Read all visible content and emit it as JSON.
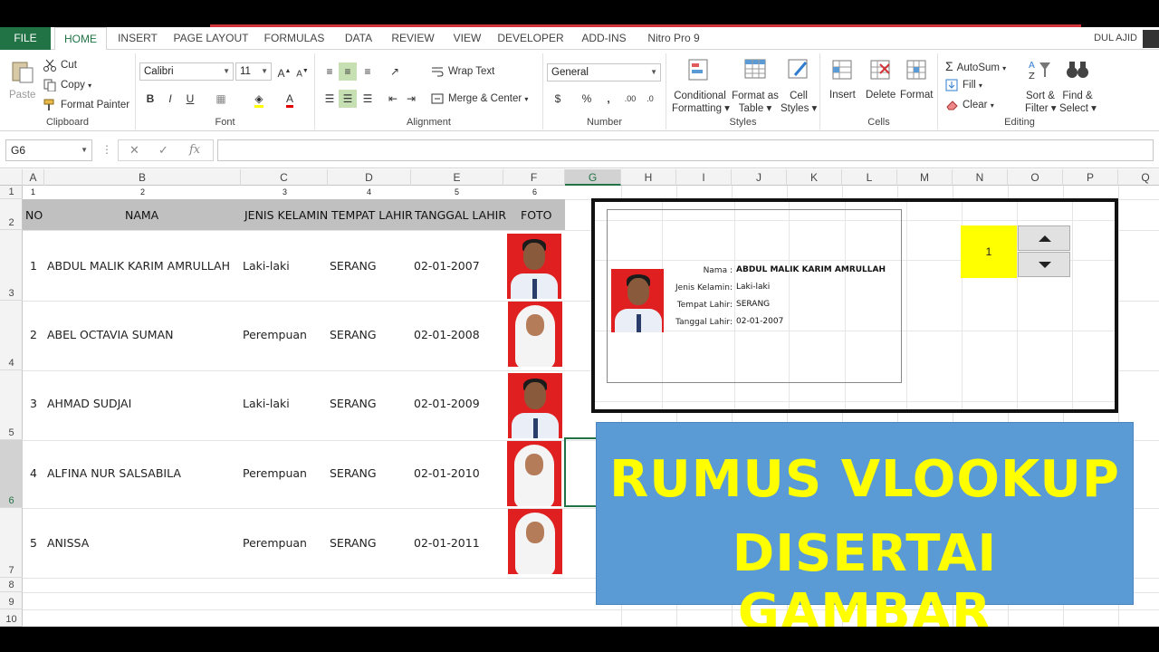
{
  "app": {
    "user": "DUL AJID",
    "accent": "#217346"
  },
  "tabs": [
    "FILE",
    "HOME",
    "INSERT",
    "PAGE LAYOUT",
    "FORMULAS",
    "DATA",
    "REVIEW",
    "VIEW",
    "DEVELOPER",
    "ADD-INS",
    "Nitro Pro 9"
  ],
  "ribbon": {
    "clipboard": {
      "paste": "Paste",
      "cut": "Cut",
      "copy": "Copy",
      "format_painter": "Format Painter",
      "label": "Clipboard"
    },
    "font": {
      "name": "Calibri",
      "size": "11",
      "label": "Font"
    },
    "alignment": {
      "wrap": "Wrap Text",
      "merge": "Merge & Center",
      "label": "Alignment"
    },
    "number": {
      "format": "General",
      "label": "Number"
    },
    "styles": {
      "conditional": [
        "Conditional",
        "Formatting"
      ],
      "format_table": [
        "Format as",
        "Table"
      ],
      "cell_styles": [
        "Cell",
        "Styles"
      ],
      "label": "Styles"
    },
    "cells": {
      "insert": "Insert",
      "delete": "Delete",
      "format": "Format",
      "label": "Cells"
    },
    "editing": {
      "autosum": "AutoSum",
      "fill": "Fill",
      "clear": "Clear",
      "sort": [
        "Sort &",
        "Filter"
      ],
      "find": [
        "Find &",
        "Select"
      ],
      "label": "Editing"
    }
  },
  "formula_bar": {
    "name_box": "G6",
    "fx": "fx",
    "value": ""
  },
  "columns": [
    "A",
    "B",
    "C",
    "D",
    "E",
    "F",
    "G",
    "H",
    "I",
    "J",
    "K",
    "L",
    "M",
    "N",
    "O",
    "P",
    "Q"
  ],
  "rows": [
    "1",
    "2",
    "3",
    "4",
    "5",
    "6",
    "7",
    "8",
    "9",
    "10"
  ],
  "index_row": [
    "1",
    "2",
    "3",
    "4",
    "5",
    "6"
  ],
  "table": {
    "headers": [
      "NO",
      "NAMA",
      "JENIS KELAMIN",
      "TEMPAT LAHIR",
      "TANGGAL LAHIR",
      "FOTO"
    ],
    "rows": [
      [
        "1",
        "ABDUL MALIK KARIM AMRULLAH",
        "Laki-laki",
        "SERANG",
        "02-01-2007"
      ],
      [
        "2",
        "ABEL OCTAVIA SUMAN",
        "Perempuan",
        "SERANG",
        "02-01-2008"
      ],
      [
        "3",
        "AHMAD SUDJAI",
        "Laki-laki",
        "SERANG",
        "02-01-2009"
      ],
      [
        "4",
        "ALFINA NUR SALSABILA",
        "Perempuan",
        "SERANG",
        "02-01-2010"
      ],
      [
        "5",
        "ANISSA",
        "Perempuan",
        "SERANG",
        "02-01-2011"
      ]
    ]
  },
  "card": {
    "labels": [
      "Nama :",
      "Jenis Kelamin:",
      "Tempat Lahir:",
      "Tanggal Lahir:"
    ],
    "values": [
      "ABDUL MALIK KARIM AMRULLAH",
      "Laki-laki",
      "SERANG",
      "02-01-2007"
    ]
  },
  "spinner": {
    "value": "1"
  },
  "banner": {
    "line1": "RUMUS VLOOKUP",
    "line2": "DISERTAI GAMBAR",
    "color": "#ffff00",
    "bg": "#5b9bd5"
  }
}
